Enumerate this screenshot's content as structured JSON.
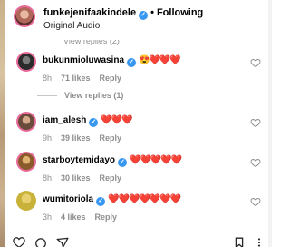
{
  "header": {
    "username": "funkejenifaakindele",
    "separator": "•",
    "follow_status": "Following",
    "audio": "Original Audio",
    "verified_glyph": "✓"
  },
  "cut_off_text": "View replies (2)",
  "comments": [
    {
      "username": "bukunmioluwasina",
      "verified": true,
      "text": "😍❤️❤️❤️",
      "time": "8h",
      "likes": "71 likes",
      "reply": "Reply",
      "view_replies": "View replies (1)",
      "avatar_color": "#2b2b2b"
    },
    {
      "username": "iam_alesh",
      "verified": true,
      "text": "❤️❤️❤️",
      "time": "9h",
      "likes": "39 likes",
      "reply": "Reply",
      "avatar_color": "#6a4a3a"
    },
    {
      "username": "starboytemidayo",
      "verified": true,
      "text": "❤️❤️❤️❤️❤️",
      "time": "8h",
      "likes": "30 likes",
      "reply": "Reply",
      "avatar_color": "#8a5a2a"
    },
    {
      "username": "wumitoriola",
      "verified": true,
      "text": "❤️❤️❤️❤️❤️❤️❤️",
      "time": "3h",
      "likes": "4 likes",
      "reply": "Reply",
      "avatar_color": "#c9b23a"
    }
  ],
  "icons": {
    "like": "heart-outline-icon",
    "footer": [
      "heart-icon",
      "comment-icon",
      "share-icon",
      "bookmark-icon",
      "more-icon"
    ]
  },
  "colors": {
    "verified": "#3897f0",
    "muted_text": "#8e8e8e",
    "story_ring": "#e86a9a"
  }
}
